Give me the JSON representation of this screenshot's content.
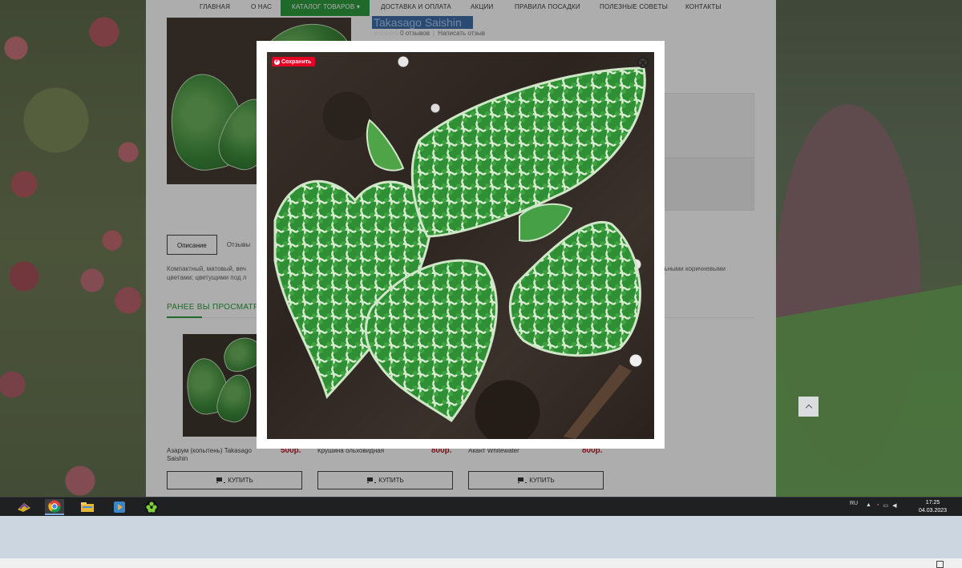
{
  "nav": {
    "items": [
      "ГЛАВНАЯ",
      "О НАС",
      "КАТАЛОГ ТОВАРОВ",
      "ДОСТАВКА И ОПЛАТА",
      "АКЦИИ",
      "ПРАВИЛА ПОСАДКИ",
      "ПОЛЕЗНЫЕ СОВЕТЫ",
      "КОНТАКТЫ"
    ],
    "active_index": 2,
    "accent": "#2f9b3f"
  },
  "product": {
    "title_visible": "Takasago Saishin",
    "reviews": "0 отзывов",
    "write_review": "Написать отзыв"
  },
  "tabs": [
    "Описание",
    "Отзывы"
  ],
  "description": {
    "left": "Компактный, матовый, веч цветами; цветущими под л",
    "right": "тельными коричневыми"
  },
  "recent": {
    "title": "РАНЕЕ ВЫ ПРОСМАТРИ",
    "products": [
      {
        "name": "Азарум (копытень) Takasago Saishin",
        "price": "500р.",
        "buy": "КУПИТЬ"
      },
      {
        "name": "Крушина ольховидная",
        "price": "800р.",
        "buy": "КУПИТЬ"
      },
      {
        "name": "Акант Whitewater",
        "price": "800р.",
        "buy": "КУПИТЬ"
      }
    ]
  },
  "lightbox": {
    "save_label": "Сохранить",
    "pin_brand_color": "#e60023"
  },
  "taskbar": {
    "apps": [
      "winamp-icon",
      "chrome-icon",
      "file-explorer-icon",
      "media-player-icon",
      "green-app-icon"
    ],
    "lang": "RU",
    "time": "17:25",
    "date": "04.03.2023"
  }
}
